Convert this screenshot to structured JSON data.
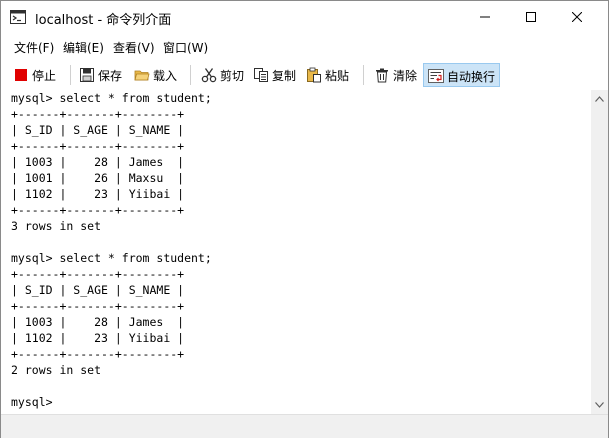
{
  "window": {
    "title": "localhost - 命令列介面"
  },
  "menu": [
    "文件(F)",
    "编辑(E)",
    "查看(V)",
    "窗口(W)"
  ],
  "toolbar": {
    "stop": "停止",
    "save": "保存",
    "load": "载入",
    "cut": "剪切",
    "copy": "复制",
    "paste": "粘贴",
    "clear": "清除",
    "wrap": "自动换行"
  },
  "colors": {
    "stop_icon": "#e00000",
    "load_icon": "#e8b84a",
    "wrap_active_bg": "#cce4f7"
  },
  "console_lines": [
    "mysql> select * from student;",
    "+------+-------+--------+",
    "| S_ID | S_AGE | S_NAME |",
    "+------+-------+--------+",
    "| 1003 |    28 | James  |",
    "| 1001 |    26 | Maxsu  |",
    "| 1102 |    23 | Yiibai |",
    "+------+-------+--------+",
    "3 rows in set",
    "",
    "mysql> select * from student;",
    "+------+-------+--------+",
    "| S_ID | S_AGE | S_NAME |",
    "+------+-------+--------+",
    "| 1003 |    28 | James  |",
    "| 1102 |    23 | Yiibai |",
    "+------+-------+--------+",
    "2 rows in set",
    "",
    "mysql>"
  ]
}
